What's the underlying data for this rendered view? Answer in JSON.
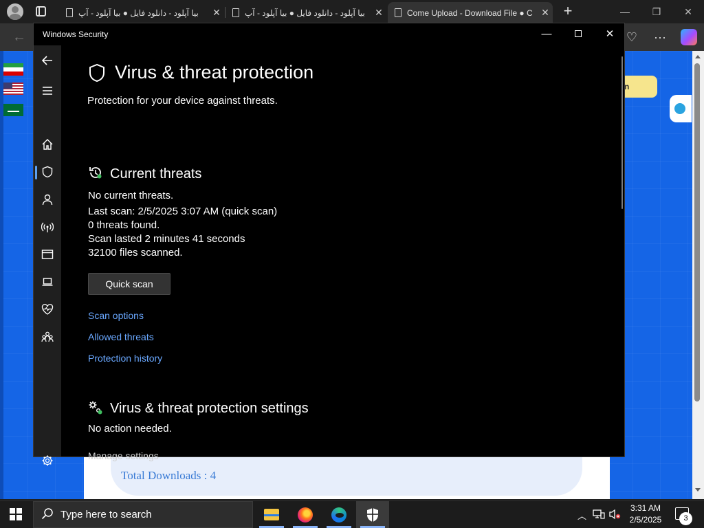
{
  "browser": {
    "tabs": [
      {
        "title": "بیا آپلود - دانلود فایل ● بیا آپلود - آپ"
      },
      {
        "title": "بیا آپلود - دانلود فایل ● بیا آپلود - آپ"
      },
      {
        "title": "Come Upload - Download File ● C"
      }
    ],
    "active_tab_index": 2,
    "new_tab_symbol": "+"
  },
  "webpage": {
    "yellow_button_fragment": "n",
    "total_downloads": "Total Downloads : 4"
  },
  "windows_security": {
    "window_title": "Windows Security",
    "page_title": "Virus & threat protection",
    "page_subtitle": "Protection for your device against threats.",
    "current_threats": {
      "heading": "Current threats",
      "status": "No current threats.",
      "last_scan": "Last scan: 2/5/2025 3:07 AM (quick scan)",
      "threats_found": "0 threats found.",
      "scan_duration": "Scan lasted 2 minutes 41 seconds",
      "files_scanned": "32100 files scanned.",
      "quick_scan_label": "Quick scan",
      "links": [
        "Scan options",
        "Allowed threats",
        "Protection history"
      ]
    },
    "settings": {
      "heading": "Virus & threat protection settings",
      "status": "No action needed.",
      "manage_link": "Manage settings"
    },
    "selected_nav": "virus-threat-protection",
    "accent_color": "#6aa8ff"
  },
  "taskbar": {
    "search_placeholder": "Type here to search",
    "time": "3:31 AM",
    "date": "2/5/2025",
    "notification_count": "3"
  }
}
